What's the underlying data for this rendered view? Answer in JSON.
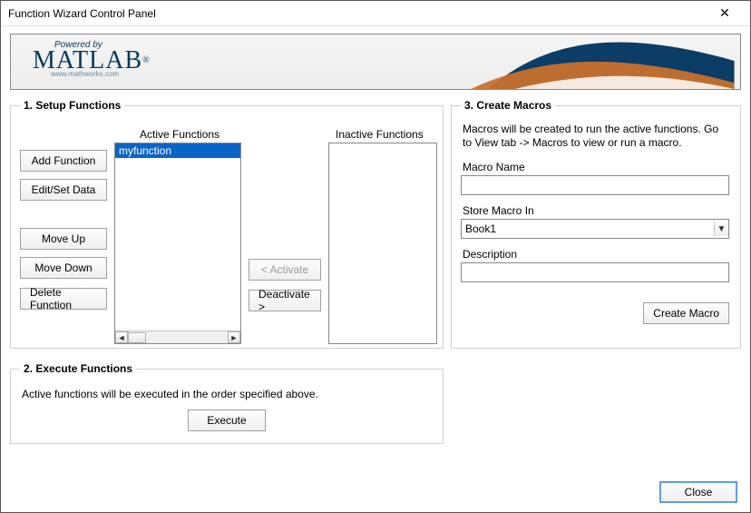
{
  "window": {
    "title": "Function Wizard Control Panel"
  },
  "banner": {
    "powered_by": "Powered by",
    "product": "MATLAB",
    "reg": "®",
    "site": "www.mathworks.com"
  },
  "setup": {
    "legend": "1. Setup Functions",
    "active_label": "Active Functions",
    "inactive_label": "Inactive Functions",
    "buttons": {
      "add": "Add Function",
      "edit": "Edit/Set Data",
      "move_up": "Move Up",
      "move_down": "Move Down",
      "delete": "Delete Function",
      "activate": "< Activate",
      "deactivate": "Deactivate >"
    },
    "active_items": [
      "myfunction"
    ],
    "inactive_items": []
  },
  "execute": {
    "legend": "2. Execute Functions",
    "text": "Active functions will be executed in the order specified above.",
    "button": "Execute"
  },
  "macros": {
    "legend": "3. Create Macros",
    "help": "Macros will be created to run the active functions. Go to View tab -> Macros to view or run a macro.",
    "name_label": "Macro Name",
    "name_value": "",
    "store_label": "Store Macro In",
    "store_value": "Book1",
    "desc_label": "Description",
    "desc_value": "",
    "create_button": "Create Macro"
  },
  "footer": {
    "close": "Close"
  }
}
